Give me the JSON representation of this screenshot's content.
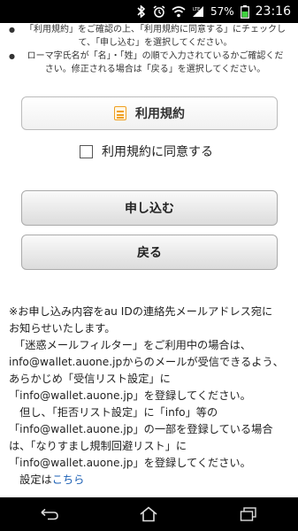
{
  "status_bar": {
    "battery": "57%",
    "time": "23:16",
    "icons": [
      "bluetooth-icon",
      "alarm-icon",
      "wifi-icon",
      "lte-signal-icon",
      "battery-icon"
    ]
  },
  "notes": [
    "「利用規約」をご確認の上、「利用規約に同意する」にチェックして、「申し込む」を選択してください。",
    "ローマ字氏名が「名」・「姓」の順で入力されているかご確認ください。修正される場合は「戻る」を選択してください。"
  ],
  "terms_button": {
    "label": "利用規約"
  },
  "agree_checkbox": {
    "label": "利用規約に同意する",
    "checked": false
  },
  "apply_button": {
    "label": "申し込む"
  },
  "back_button": {
    "label": "戻る"
  },
  "info": {
    "lines": [
      "※お申し込み内容をau IDの連絡先メールアドレス宛に",
      "お知らせいたします。",
      "　「迷惑メールフィルター」をご利用中の場合は、",
      "info@wallet.auone.jpからのメールが受信できるよう、",
      "あらかじめ「受信リスト設定」に",
      "「info@wallet.auone.jp」を登録してください。",
      "　但し、「拒否リスト設定」に「info」等の",
      "「info@wallet.auone.jp」の一部を登録している場合",
      "は、「なりすまし規制回避リスト」に",
      "「info@wallet.auone.jp」を登録してください。"
    ],
    "last_prefix": "　設定は",
    "last_link": "こちら",
    "link_color": "#1a5fb4"
  },
  "nav_bar": {
    "icons": [
      "back-icon",
      "home-icon",
      "recent-apps-icon"
    ]
  }
}
